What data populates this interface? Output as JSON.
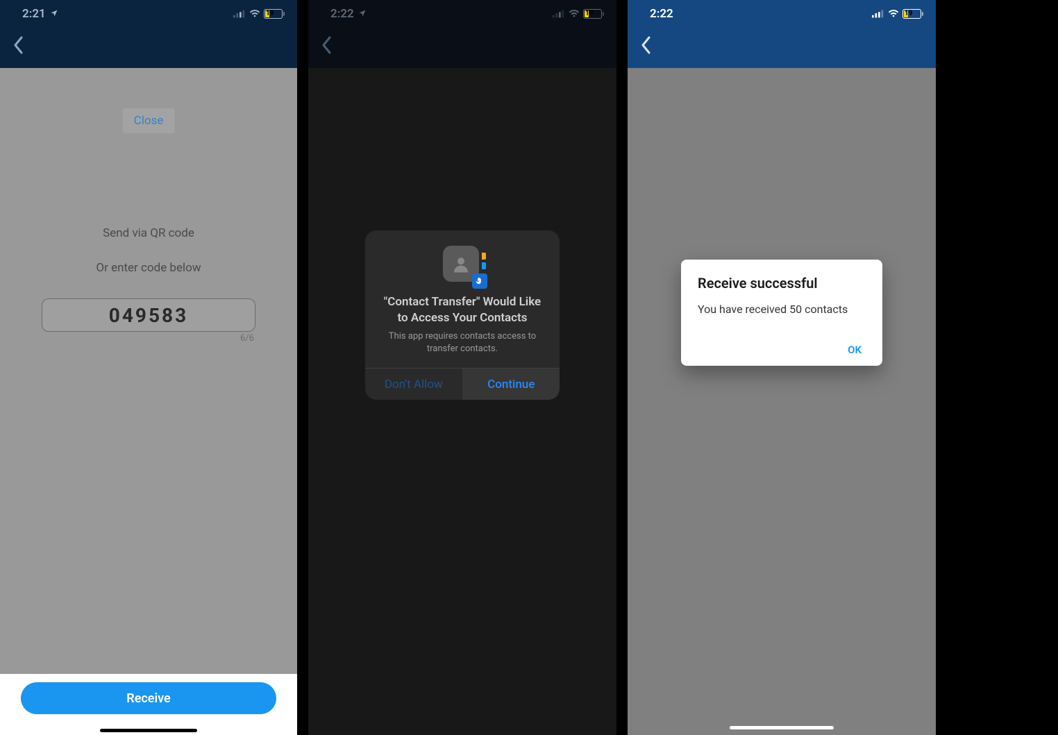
{
  "phone1": {
    "status": {
      "time": "2:21",
      "battery": "19"
    },
    "close": "Close",
    "send_qr": "Send via QR code",
    "enter_code": "Or enter code below",
    "code": "049583",
    "code_count": "6/6",
    "receive": "Receive"
  },
  "phone2": {
    "status": {
      "time": "2:22",
      "battery": "19"
    },
    "perm_title": "\"Contact Transfer\" Would Like to Access Your Contacts",
    "perm_msg": "This app requires contacts access to transfer contacts.",
    "deny": "Don't Allow",
    "allow": "Continue"
  },
  "phone3": {
    "status": {
      "time": "2:22",
      "battery": "19"
    },
    "title": "Receive successful",
    "msg": "You have received 50 contacts",
    "ok": "OK"
  }
}
